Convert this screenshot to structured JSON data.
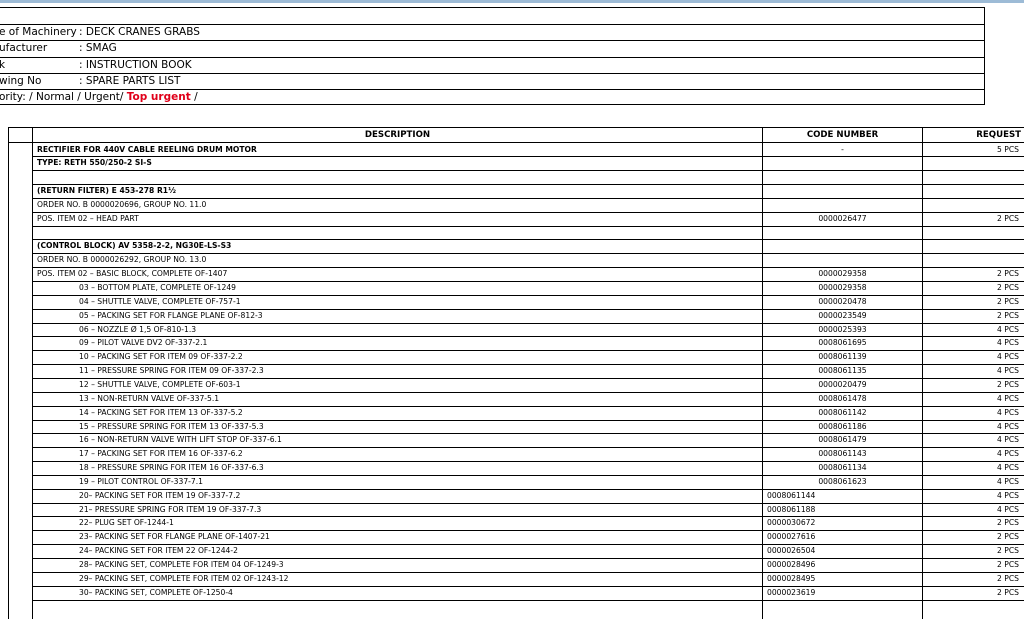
{
  "info": [
    {
      "label": "e of Machinery",
      "value": ":  DECK CRANES GRABS"
    },
    {
      "label": "ufacturer",
      "value": ":  SMAG"
    },
    {
      "label": "k",
      "value": ": INSTRUCTION BOOK"
    },
    {
      "label": "wing No",
      "value": ": SPARE PARTS LIST"
    }
  ],
  "priority": {
    "prefix": "ority: / Normal / Urgent/ ",
    "top": "Top urgent",
    "suffix": " /"
  },
  "table": {
    "headers": {
      "description": "DESCRIPTION",
      "code": "CODE NUMBER",
      "requested": "REQUEST"
    },
    "rows": [
      {
        "d": "RECTIFIER FOR 440V CABLE REELING DRUM MOTOR",
        "c": "-",
        "q": "5 PCS",
        "bold": true,
        "indent": 0,
        "codeAlign": "center"
      },
      {
        "d": "TYPE: RETH 550/250-2 SI-S",
        "c": "",
        "q": "",
        "bold": true,
        "indent": 0
      },
      {
        "d": "",
        "c": "",
        "q": "",
        "indent": 0
      },
      {
        "d": "(RETURN FILTER) E 453-278 R1½",
        "c": "",
        "q": "",
        "bold": true,
        "indent": 0
      },
      {
        "d": "ORDER NO. B 0000020696, GROUP NO. 11.0",
        "c": "",
        "q": "",
        "indent": 0
      },
      {
        "d": "POS. ITEM 02 – HEAD PART",
        "c": "0000026477",
        "q": "2 PCS",
        "indent": 0,
        "codeAlign": "center"
      },
      {
        "d": "",
        "c": "",
        "q": "",
        "indent": 0
      },
      {
        "d": "(CONTROL BLOCK) AV 5358-2-2, NG30E-LS-S3",
        "c": "",
        "q": "",
        "bold": true,
        "indent": 0
      },
      {
        "d": "ORDER NO. B 0000026292, GROUP NO. 13.0",
        "c": "",
        "q": "",
        "indent": 0
      },
      {
        "d": "POS. ITEM 02 – BASIC BLOCK, COMPLETE   OF-1407",
        "c": "0000029358",
        "q": "2 PCS",
        "indent": 0,
        "codeAlign": "center"
      },
      {
        "d": "03 – BOTTOM PLATE, COMPLETE   OF-1249",
        "c": "0000029358",
        "q": "2 PCS",
        "indent": 1,
        "codeAlign": "center"
      },
      {
        "d": "04 – SHUTTLE VALVE, COMPLETE   OF-757-1",
        "c": "0000020478",
        "q": "2 PCS",
        "indent": 1,
        "codeAlign": "center"
      },
      {
        "d": "05 – PACKING SET FOR FLANGE PLANE   OF-812-3",
        "c": "0000023549",
        "q": "2 PCS",
        "indent": 1,
        "codeAlign": "center"
      },
      {
        "d": "06 – NOZZLE Ø 1,5   OF-810-1.3",
        "c": "0000025393",
        "q": "4 PCS",
        "indent": 1,
        "codeAlign": "center"
      },
      {
        "d": "09 – PILOT VALVE DV2   OF-337-2.1",
        "c": "0008061695",
        "q": "4 PCS",
        "indent": 1,
        "codeAlign": "center"
      },
      {
        "d": "10 – PACKING SET FOR ITEM 09   OF-337-2.2",
        "c": "0008061139",
        "q": "4 PCS",
        "indent": 1,
        "codeAlign": "center"
      },
      {
        "d": "11 – PRESSURE SPRING FOR ITEM 09   OF-337-2.3",
        "c": "0008061135",
        "q": "4 PCS",
        "indent": 1,
        "codeAlign": "center"
      },
      {
        "d": "12 – SHUTTLE VALVE, COMPLETE   OF-603-1",
        "c": "0000020479",
        "q": "2 PCS",
        "indent": 1,
        "codeAlign": "center"
      },
      {
        "d": "13 – NON-RETURN VALVE   OF-337-5.1",
        "c": "0008061478",
        "q": "4 PCS",
        "indent": 1,
        "codeAlign": "center"
      },
      {
        "d": "14 – PACKING SET FOR ITEM 13   OF-337-5.2",
        "c": "0008061142",
        "q": "4 PCS",
        "indent": 1,
        "codeAlign": "center"
      },
      {
        "d": "15 – PRESSURE SPRING FOR ITEM 13   OF-337-5.3",
        "c": "0008061186",
        "q": "4 PCS",
        "indent": 1,
        "codeAlign": "center"
      },
      {
        "d": "16 – NON-RETURN VALVE WITH LIFT STOP   OF-337-6.1",
        "c": "0008061479",
        "q": "4 PCS",
        "indent": 1,
        "codeAlign": "center"
      },
      {
        "d": "17 – PACKING SET FOR ITEM 16   OF-337-6.2",
        "c": "0008061143",
        "q": "4 PCS",
        "indent": 1,
        "codeAlign": "center"
      },
      {
        "d": "18 – PRESSURE SPRING FOR ITEM 16   OF-337-6.3",
        "c": "0008061134",
        "q": "4 PCS",
        "indent": 1,
        "codeAlign": "center"
      },
      {
        "d": "19 – PILOT CONTROL   OF-337-7.1",
        "c": "0008061623",
        "q": "4 PCS",
        "indent": 1,
        "codeAlign": "center"
      },
      {
        "d": "20– PACKING SET FOR ITEM 19   OF-337-7.2",
        "c": "0008061144",
        "q": "4 PCS",
        "indent": 1,
        "codeAlign": "left"
      },
      {
        "d": "21– PRESSURE SPRING FOR ITEM 19   OF-337-7.3",
        "c": "0008061188",
        "q": "4 PCS",
        "indent": 1,
        "codeAlign": "left"
      },
      {
        "d": "22– PLUG SET   OF-1244-1",
        "c": "0000030672",
        "q": "2 PCS",
        "indent": 1,
        "codeAlign": "left"
      },
      {
        "d": "23– PACKING SET FOR FLANGE PLANE   OF-1407-21",
        "c": "0000027616",
        "q": "2 PCS",
        "indent": 1,
        "codeAlign": "left"
      },
      {
        "d": "24– PACKING SET FOR ITEM 22   OF-1244-2",
        "c": "0000026504",
        "q": "2 PCS",
        "indent": 1,
        "codeAlign": "left"
      },
      {
        "d": "28– PACKING SET, COMPLETE FOR ITEM 04   OF-1249-3",
        "c": "0000028496",
        "q": "2 PCS",
        "indent": 1,
        "codeAlign": "left"
      },
      {
        "d": "29– PACKING SET, COMPLETE FOR ITEM 02   OF-1243-12",
        "c": "0000028495",
        "q": "2 PCS",
        "indent": 1,
        "codeAlign": "left"
      },
      {
        "d": "30– PACKING SET, COMPLETE   OF-1250-4",
        "c": "0000023619",
        "q": "2 PCS",
        "indent": 1,
        "codeAlign": "left"
      }
    ]
  }
}
